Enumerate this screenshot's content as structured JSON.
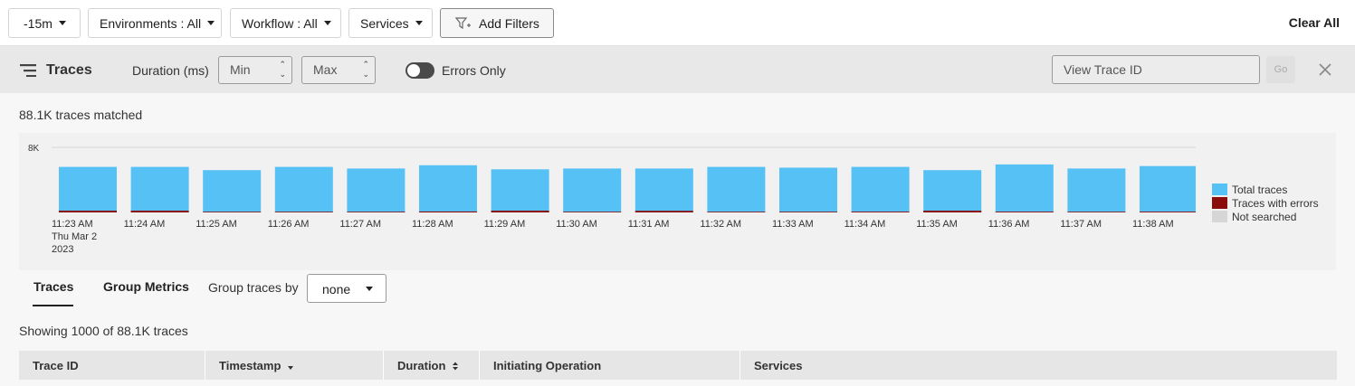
{
  "filters": {
    "time_range": "-15m",
    "environments": "Environments : All",
    "workflow": "Workflow : All",
    "services": "Services",
    "add_filters": "Add Filters",
    "clear_all": "Clear All"
  },
  "trace_bar": {
    "title": "Traces",
    "duration_label": "Duration (ms)",
    "min_placeholder": "Min",
    "max_placeholder": "Max",
    "errors_only_label": "Errors Only",
    "errors_only_on": false,
    "trace_id_placeholder": "View Trace ID",
    "go_label": "Go"
  },
  "summary": {
    "matched": "88.1K traces matched"
  },
  "chart_data": {
    "type": "bar",
    "stacked": true,
    "categories": [
      "11:23 AM",
      "11:24 AM",
      "11:25 AM",
      "11:26 AM",
      "11:27 AM",
      "11:28 AM",
      "11:29 AM",
      "11:30 AM",
      "11:31 AM",
      "11:32 AM",
      "11:33 AM",
      "11:34 AM",
      "11:35 AM",
      "11:36 AM",
      "11:37 AM",
      "11:38 AM"
    ],
    "first_label_date": [
      "Thu Mar 2",
      "2023"
    ],
    "y_tick": "8K",
    "ylim": [
      0,
      8000
    ],
    "series": [
      {
        "name": "Total traces",
        "color": "#56c1f5",
        "values": [
          5600,
          5600,
          5200,
          5600,
          5400,
          5800,
          5300,
          5400,
          5400,
          5600,
          5500,
          5600,
          5200,
          5900,
          5400,
          5700
        ]
      },
      {
        "name": "Traces with errors",
        "color": "#8b0c0c",
        "values": [
          220,
          220,
          60,
          80,
          60,
          120,
          220,
          80,
          200,
          80,
          60,
          100,
          220,
          100,
          60,
          100
        ]
      },
      {
        "name": "Not searched",
        "color": "#d6d6d6",
        "values": [
          0,
          0,
          0,
          0,
          0,
          0,
          0,
          0,
          0,
          0,
          0,
          0,
          0,
          0,
          0,
          0
        ]
      }
    ],
    "legend_position": "right",
    "grid": true
  },
  "tabs": [
    {
      "label": "Traces",
      "active": true
    },
    {
      "label": "Group Metrics",
      "active": false
    }
  ],
  "group_by": {
    "label": "Group traces by",
    "value": "none"
  },
  "table": {
    "showing": "Showing 1000 of 88.1K traces",
    "columns": [
      "Trace ID",
      "Timestamp",
      "Duration",
      "Initiating Operation",
      "Services"
    ]
  }
}
